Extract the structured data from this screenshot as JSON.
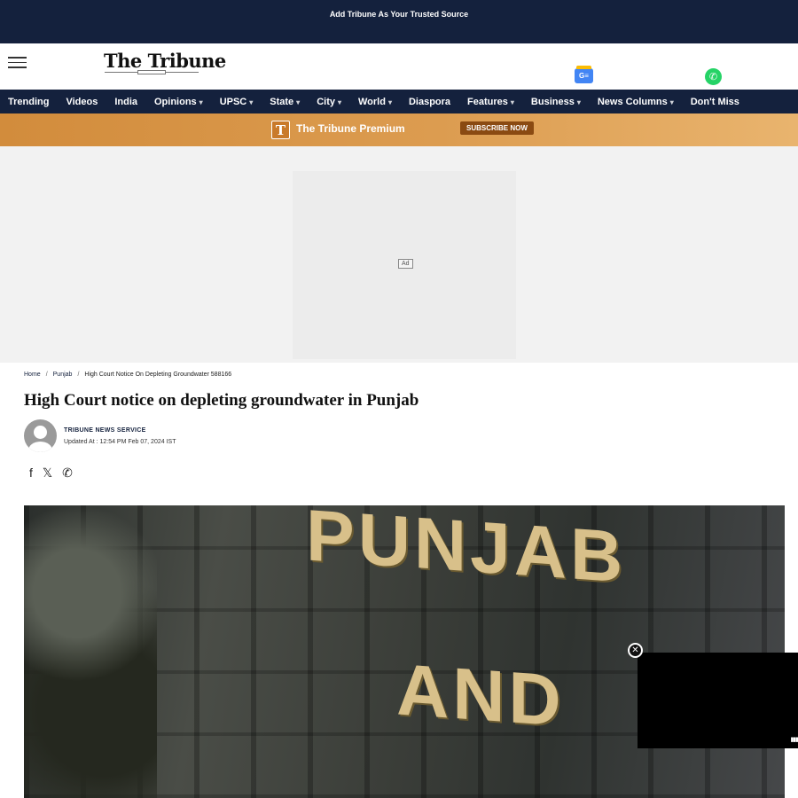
{
  "topbar": {
    "text": "Add Tribune As Your Trusted Source"
  },
  "header": {
    "logo": "The Tribune",
    "gnews_label": "G≡"
  },
  "nav": {
    "items": [
      {
        "label": "Trending",
        "dropdown": false
      },
      {
        "label": "Videos",
        "dropdown": false
      },
      {
        "label": "India",
        "dropdown": false
      },
      {
        "label": "Opinions",
        "dropdown": true
      },
      {
        "label": "UPSC",
        "dropdown": true
      },
      {
        "label": "State",
        "dropdown": true
      },
      {
        "label": "City",
        "dropdown": true
      },
      {
        "label": "World",
        "dropdown": true
      },
      {
        "label": "Diaspora",
        "dropdown": false
      },
      {
        "label": "Features",
        "dropdown": true
      },
      {
        "label": "Business",
        "dropdown": true
      },
      {
        "label": "News Columns",
        "dropdown": true
      },
      {
        "label": "Don't Miss",
        "dropdown": false
      }
    ],
    "caret": "▾"
  },
  "premium": {
    "badge": "T",
    "title": "The Tribune Premium",
    "subscribe": "SUBSCRIBE NOW"
  },
  "ad": {
    "label": "Ad"
  },
  "breadcrumb": {
    "home": "Home",
    "section": "Punjab",
    "current": "High Court Notice On Depleting Groundwater 588166",
    "sep": "/"
  },
  "article": {
    "headline": "High Court notice on depleting groundwater in Punjab",
    "author": "TRIBUNE NEWS SERVICE",
    "updated": "Updated At : 12:54 PM Feb 07, 2024 IST"
  },
  "share": {
    "facebook": "f",
    "x": "𝕏",
    "whatsapp": "✆"
  },
  "hero": {
    "line1": "PUNJAB",
    "line2": "AND"
  },
  "video": {
    "close": "✕"
  }
}
